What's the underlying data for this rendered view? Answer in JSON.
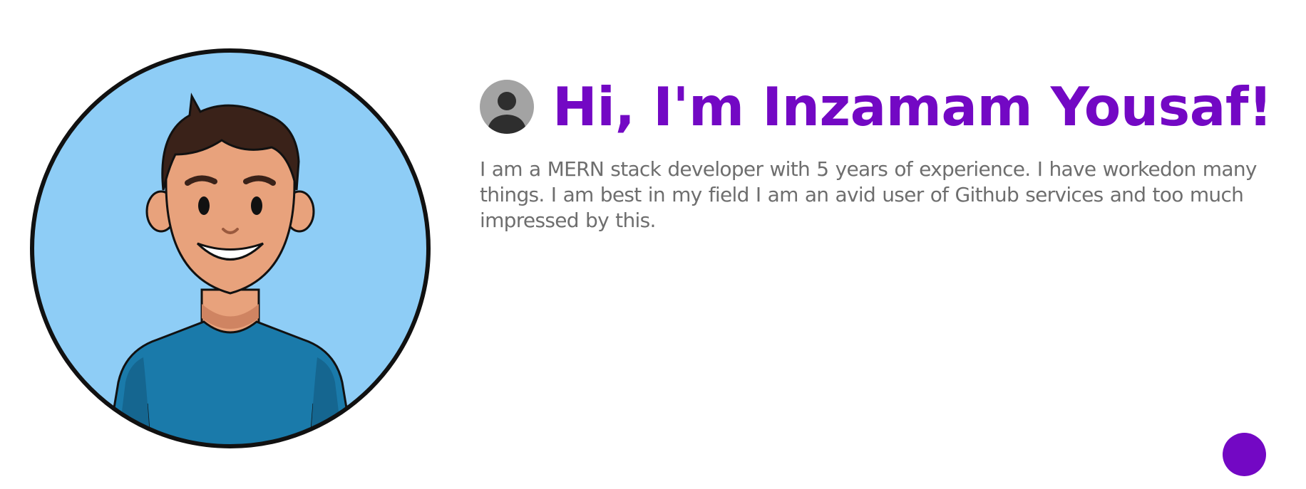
{
  "hero": {
    "avatar_icon": "cartoon-man-avatar",
    "heading_icon": "user-circle-icon",
    "title": "Hi, I'm Inzamam Yousaf!",
    "bio": "I am a MERN stack developer with 5 years of experience. I have workedon many things. I am best in my field I am an avid user of Github services and too much impressed by this."
  },
  "fab": {
    "icon": "purple-circle-button"
  },
  "colors": {
    "accent": "#7308c4",
    "text_muted": "#6e6e6e",
    "icon_gray": "#a3a3a3",
    "icon_dark": "#2e2e2e",
    "avatar_bg": "#8ecdf6",
    "shirt": "#1a7aaa",
    "skin": "#e8a27c",
    "hair": "#3a2219",
    "outline": "#111111"
  }
}
